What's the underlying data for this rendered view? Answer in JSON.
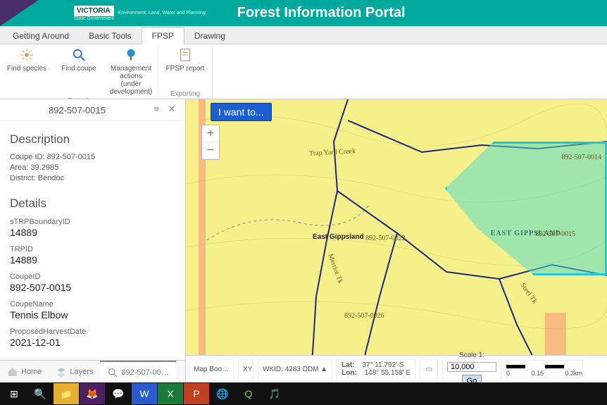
{
  "header": {
    "brand_state": "State Government",
    "brand_name": "VICTORIA",
    "dept": "Environment, Land, Water and Planning",
    "app_title": "Forest Information Portal"
  },
  "tabs": [
    "Getting Around",
    "Basic Tools",
    "FPSP",
    "Drawing"
  ],
  "active_tab": "FPSP",
  "ribbon": {
    "groups": [
      {
        "caption": "Search",
        "items": [
          {
            "label": "Find species"
          },
          {
            "label": "Find coupe"
          },
          {
            "label": "Management actions (under development)"
          }
        ]
      },
      {
        "caption": "Exporting",
        "items": [
          {
            "label": "FPSP report"
          }
        ]
      }
    ]
  },
  "panel": {
    "title": "892-507-0015",
    "menu_icon": "≡",
    "close_icon": "✕",
    "description_h": "Description",
    "desc_lines": [
      "Coupe ID: 892-507-0015",
      "Area: 39.2985",
      "District: Bendoc"
    ],
    "details_h": "Details",
    "fields": [
      {
        "label": "sTRPBoundaryID",
        "value": "14889"
      },
      {
        "label": "TRPID",
        "value": "14889"
      },
      {
        "label": "CoupeID",
        "value": "892-507-0015"
      },
      {
        "label": "CoupeName",
        "value": "Tennis Elbow"
      },
      {
        "label": "ProposedHarvestDate",
        "value": "2021-12-01"
      }
    ]
  },
  "bottom_tabs": [
    {
      "label": "Home"
    },
    {
      "label": "Layers"
    },
    {
      "label": "892-507-00…"
    }
  ],
  "map": {
    "i_want_to": "I want to...",
    "collapse": "‹",
    "zoom_in": "+",
    "zoom_out": "−",
    "labels": {
      "trap_yard": "Trap Yard Creek",
      "east_gipps": "East Gippsland",
      "east_gipps_caps": "EAST GIPPSLAND",
      "c0022": "892-507-0022",
      "c0014": "892-507-0014",
      "c0015": "892-507-0015",
      "c0026": "892-507-0026",
      "merriot": "Merriot  Tk",
      "steel": "Steel  Tk"
    }
  },
  "statusbar": {
    "mapbook": "Map Boo…",
    "wkid": "WKID: 4283 DDM ▲",
    "lat_l": "Lat:",
    "lat_v": "37° 11.792' S",
    "lon_l": "Lon:",
    "lon_v": "148° 55.158' E",
    "scale_l": "Scale 1:",
    "scale_v": "10,000",
    "go": "Go",
    "sb0": "0",
    "sb1": "0.15",
    "sb2": "0.3km"
  },
  "taskbar": [
    "⊞",
    "🔍",
    "📁",
    "🦊",
    "💬",
    "W",
    "X",
    "P",
    "🌐",
    "Q",
    "🎵"
  ]
}
